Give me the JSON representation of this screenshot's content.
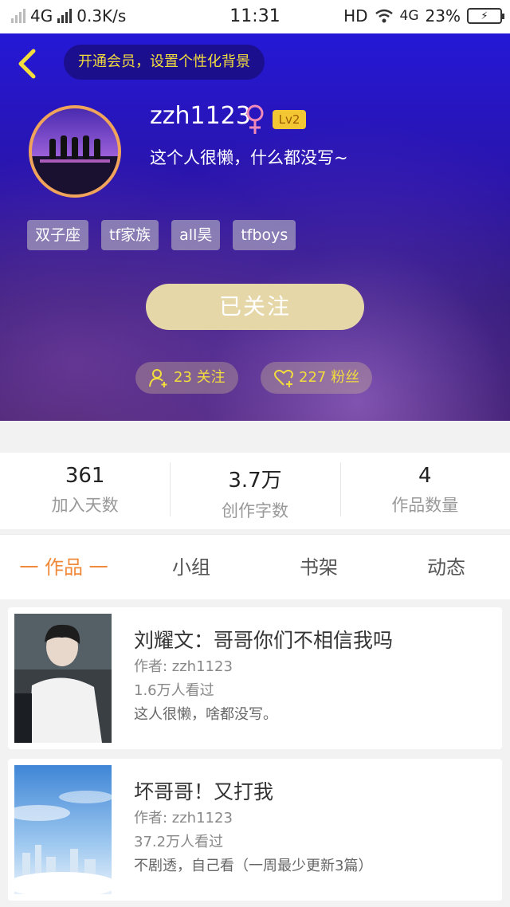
{
  "status_bar": {
    "network": "4G",
    "speed": "0.3K/s",
    "time": "11:31",
    "hd": "HD",
    "network2": "4G",
    "battery": "23%"
  },
  "header": {
    "vip_text": "开通会员，设置个性化背景",
    "username": "zzh1123",
    "level": "Lv2",
    "bio": "这个人很懒，什么都没写~",
    "tags": [
      "双子座",
      "tf家族",
      "all昊",
      "tfboys"
    ],
    "follow_button": "已关注",
    "following": "23 关注",
    "followers": "227 粉丝"
  },
  "stats": [
    {
      "value": "361",
      "label": "加入天数"
    },
    {
      "value": "3.7万",
      "label": "创作字数"
    },
    {
      "value": "4",
      "label": "作品数量"
    }
  ],
  "tabs": [
    "一 作品 一",
    "小组",
    "书架",
    "动态"
  ],
  "works": [
    {
      "title": "刘耀文：哥哥你们不相信我吗",
      "author": "作者: zzh1123",
      "views": "1.6万人看过",
      "desc": "这人很懒，啥都没写。"
    },
    {
      "title": "坏哥哥！又打我",
      "author": "作者: zzh1123",
      "views": "37.2万人看过",
      "desc": "不剧透，自己看（一周最少更新3篇）"
    }
  ],
  "colors": {
    "accent": "#f08a3a",
    "gold": "#f3dd3d",
    "follow_button": "#e6d7a8"
  }
}
